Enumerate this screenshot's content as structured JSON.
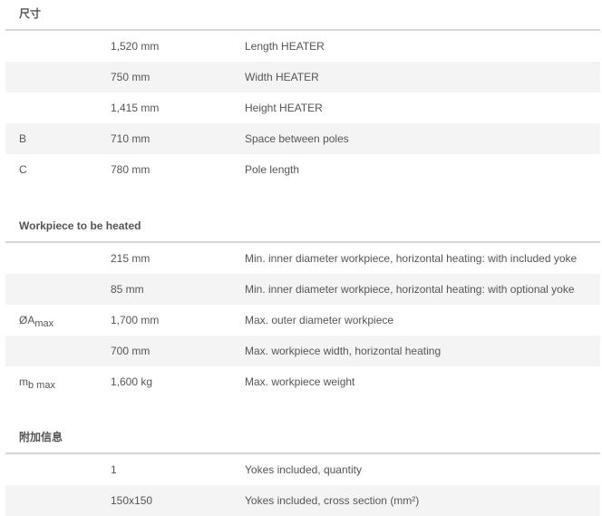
{
  "sections": [
    {
      "title": "尺寸",
      "rows": [
        {
          "symbol": "",
          "value": "1,520 mm",
          "desc": "Length HEATER"
        },
        {
          "symbol": "",
          "value": "750 mm",
          "desc": "Width HEATER"
        },
        {
          "symbol": "",
          "value": "1,415 mm",
          "desc": "Height HEATER"
        },
        {
          "symbol": "B",
          "value": "710 mm",
          "desc": "Space between poles"
        },
        {
          "symbol": "C",
          "value": "780 mm",
          "desc": "Pole length"
        }
      ]
    },
    {
      "title": "Workpiece to be heated",
      "rows": [
        {
          "symbol": "",
          "value": "215 mm",
          "desc": "Min. inner diameter workpiece, horizontal heating: with included yoke"
        },
        {
          "symbol": "",
          "value": "85 mm",
          "desc": "Min. inner diameter workpiece, horizontal heating: with optional yoke"
        },
        {
          "symbol_main": "ØA",
          "symbol_sub": "max",
          "value": "1,700 mm",
          "desc": "Max. outer diameter workpiece"
        },
        {
          "symbol": "",
          "value": "700 mm",
          "desc": "Max. workpiece width, horizontal heating"
        },
        {
          "symbol_main": "m",
          "symbol_sub": "b max",
          "value": "1,600 kg",
          "desc": "Max. workpiece weight"
        }
      ]
    },
    {
      "title": "附加信息",
      "rows": [
        {
          "symbol": "",
          "value": "1",
          "desc": "Yokes included, quantity"
        },
        {
          "symbol": "",
          "value": "150x150",
          "desc": "Yokes included, cross section (mm²)"
        }
      ]
    }
  ]
}
